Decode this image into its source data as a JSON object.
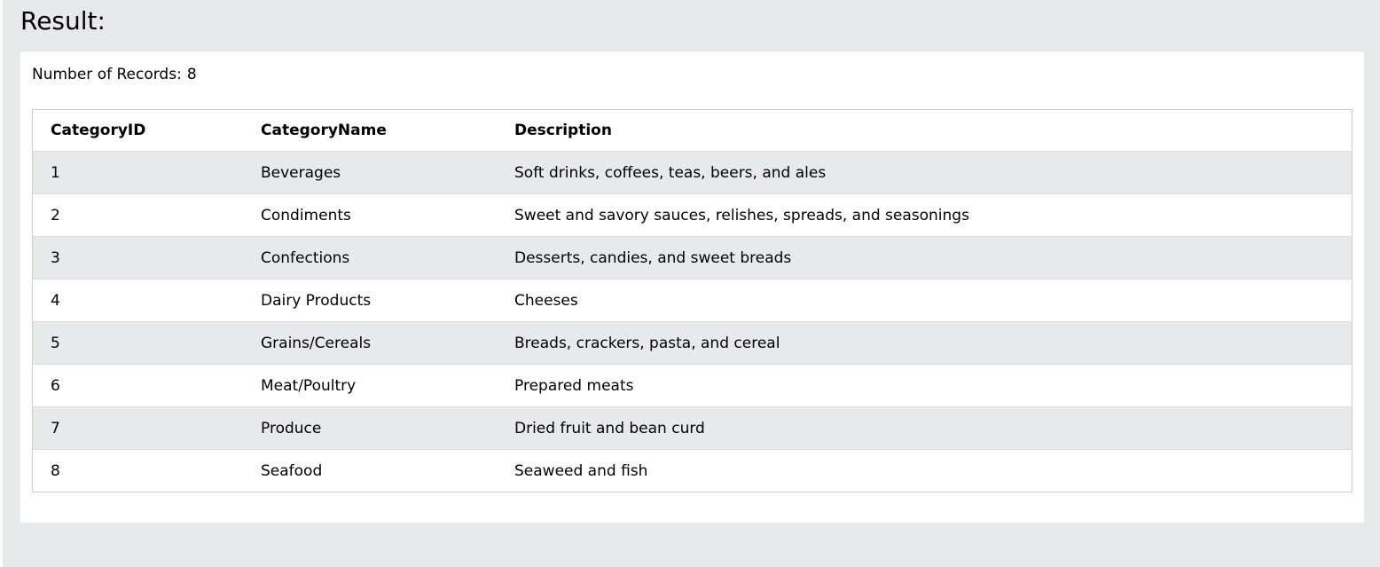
{
  "result": {
    "title": "Result:",
    "record_count_label": "Number of Records:",
    "record_count": "8"
  },
  "table": {
    "columns": [
      "CategoryID",
      "CategoryName",
      "Description"
    ],
    "rows": [
      [
        "1",
        "Beverages",
        "Soft drinks, coffees, teas, beers, and ales"
      ],
      [
        "2",
        "Condiments",
        "Sweet and savory sauces, relishes, spreads, and seasonings"
      ],
      [
        "3",
        "Confections",
        "Desserts, candies, and sweet breads"
      ],
      [
        "4",
        "Dairy Products",
        "Cheeses"
      ],
      [
        "5",
        "Grains/Cereals",
        "Breads, crackers, pasta, and cereal"
      ],
      [
        "6",
        "Meat/Poultry",
        "Prepared meats"
      ],
      [
        "7",
        "Produce",
        "Dried fruit and bean curd"
      ],
      [
        "8",
        "Seafood",
        "Seaweed and fish"
      ]
    ]
  },
  "colors": {
    "panel_background": "#e7e9eb",
    "row_stripe": "#e7e9eb",
    "box_background": "#ffffff"
  }
}
